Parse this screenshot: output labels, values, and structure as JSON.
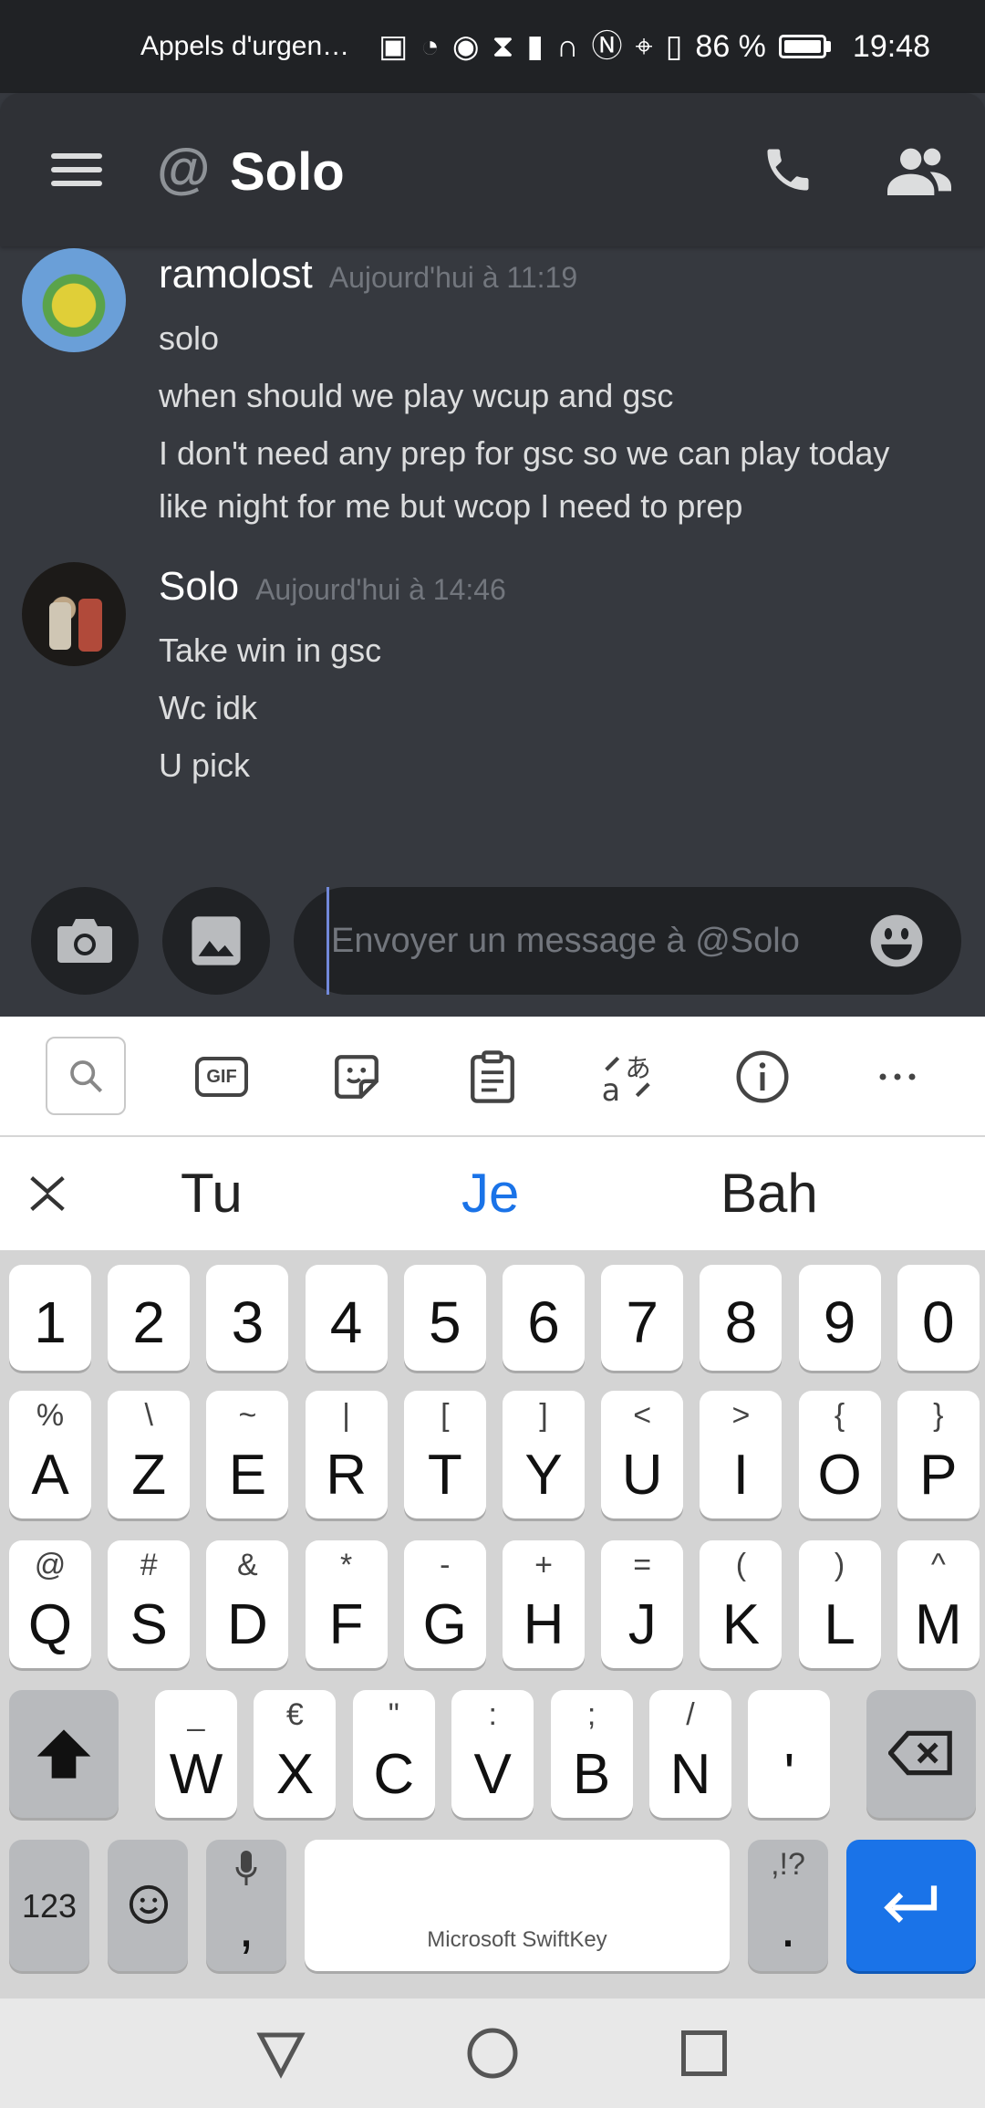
{
  "status_bar": {
    "emergency": "Appels d'urgen…",
    "battery_percent": "86 %",
    "time": "19:48"
  },
  "header": {
    "title": "Solo"
  },
  "messages": [
    {
      "author": "ramolost",
      "timestamp": "Aujourd'hui à 11:19",
      "lines": [
        "solo",
        "when should we play wcup and gsc",
        "I don't need any prep for gsc so we can play today",
        "like night for me but wcop I need to prep"
      ]
    },
    {
      "author": "Solo",
      "timestamp": "Aujourd'hui à 14:46",
      "lines": [
        "Take win in gsc",
        "Wc idk",
        "U pick"
      ]
    }
  ],
  "composer": {
    "placeholder": "Envoyer un message à @Solo"
  },
  "keyboard": {
    "toolbar": {
      "gif_label": "GIF"
    },
    "suggestions": [
      "Tu",
      "Je",
      "Bah"
    ],
    "rows": {
      "numbers": [
        "1",
        "2",
        "3",
        "4",
        "5",
        "6",
        "7",
        "8",
        "9",
        "0"
      ],
      "row1": [
        {
          "main": "A",
          "sec": "%"
        },
        {
          "main": "Z",
          "sec": "\\"
        },
        {
          "main": "E",
          "sec": "~"
        },
        {
          "main": "R",
          "sec": "|"
        },
        {
          "main": "T",
          "sec": "["
        },
        {
          "main": "Y",
          "sec": "]"
        },
        {
          "main": "U",
          "sec": "<"
        },
        {
          "main": "I",
          "sec": ">"
        },
        {
          "main": "O",
          "sec": "{"
        },
        {
          "main": "P",
          "sec": "}"
        }
      ],
      "row2": [
        {
          "main": "Q",
          "sec": "@"
        },
        {
          "main": "S",
          "sec": "#"
        },
        {
          "main": "D",
          "sec": "&"
        },
        {
          "main": "F",
          "sec": "*"
        },
        {
          "main": "G",
          "sec": "-"
        },
        {
          "main": "H",
          "sec": "+"
        },
        {
          "main": "J",
          "sec": "="
        },
        {
          "main": "K",
          "sec": "("
        },
        {
          "main": "L",
          "sec": ")"
        },
        {
          "main": "M",
          "sec": "^"
        }
      ],
      "row3": [
        {
          "main": "W",
          "sec": "_"
        },
        {
          "main": "X",
          "sec": "€"
        },
        {
          "main": "C",
          "sec": "\""
        },
        {
          "main": "V",
          "sec": ":"
        },
        {
          "main": "B",
          "sec": ";"
        },
        {
          "main": "N",
          "sec": "/"
        },
        {
          "main": "'",
          "sec": ""
        }
      ]
    },
    "bottom": {
      "numbers_label": "123",
      "comma": ",",
      "space_label": "Microsoft SwiftKey",
      "period": ".",
      "period_sec": ",!?"
    }
  },
  "icons": {
    "menu": "hamburger-icon",
    "phone": "phone-icon",
    "members": "people-icon",
    "camera": "camera-icon",
    "image": "image-icon",
    "emoji": "emoji-icon"
  },
  "colors": {
    "background": "#36393f",
    "header": "#2f3136",
    "input": "#202225",
    "accent": "#1a73e8"
  }
}
